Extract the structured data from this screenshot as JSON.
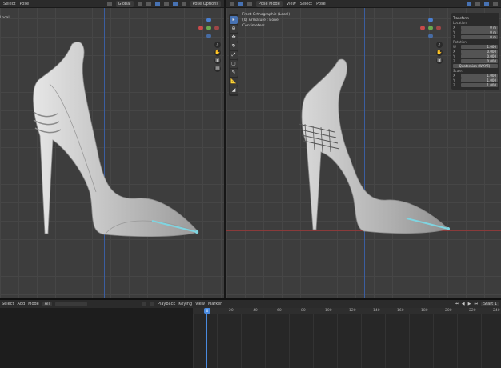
{
  "left_viewport": {
    "header": {
      "item_select": "Select",
      "item_pose": "Pose",
      "transform_orientation": "Global",
      "pose_options": "Pose Options"
    },
    "side_label": "Local"
  },
  "right_viewport": {
    "header": {
      "mode": "Pose Mode",
      "view": "View",
      "select": "Select",
      "pose": "Pose"
    },
    "info": {
      "line1": "Front Orthographic (Local)",
      "line2": "(0) Armature : Bone",
      "line3": "Centimeters"
    },
    "npanel": {
      "title": "Transform",
      "location_label": "Location:",
      "location": [
        {
          "axis": "X",
          "value": "0 m"
        },
        {
          "axis": "Y",
          "value": "0 m"
        },
        {
          "axis": "Z",
          "value": "0 m"
        }
      ],
      "rotation_label": "Rotation:",
      "rotation": [
        {
          "axis": "W",
          "value": "1.000"
        },
        {
          "axis": "X",
          "value": "0.000"
        },
        {
          "axis": "Y",
          "value": "0.000"
        },
        {
          "axis": "Z",
          "value": "0.000"
        }
      ],
      "rotation_mode": "Quaternion (WXYZ)",
      "scale_label": "Scale:",
      "scale": [
        {
          "axis": "X",
          "value": "1.000"
        },
        {
          "axis": "Y",
          "value": "1.000"
        },
        {
          "axis": "Z",
          "value": "1.000"
        }
      ]
    }
  },
  "bottom": {
    "header": {
      "select": "Select",
      "add": "Add",
      "mode": "Mode",
      "all": "All",
      "playback": "Playback",
      "keying": "Keying",
      "view": "View",
      "marker": "Marker",
      "start_label": "Start",
      "start_value": "1"
    },
    "ruler_ticks": [
      "0",
      "20",
      "40",
      "60",
      "80",
      "100",
      "120",
      "140",
      "160",
      "180",
      "200",
      "220",
      "240"
    ],
    "current_frame": "0"
  },
  "colors": {
    "accent": "#4772b3",
    "bone": "#7fd4e0",
    "x_axis": "#8a3a3a",
    "z_axis": "#3b5ea0",
    "mesh": "#c9c9c9"
  }
}
